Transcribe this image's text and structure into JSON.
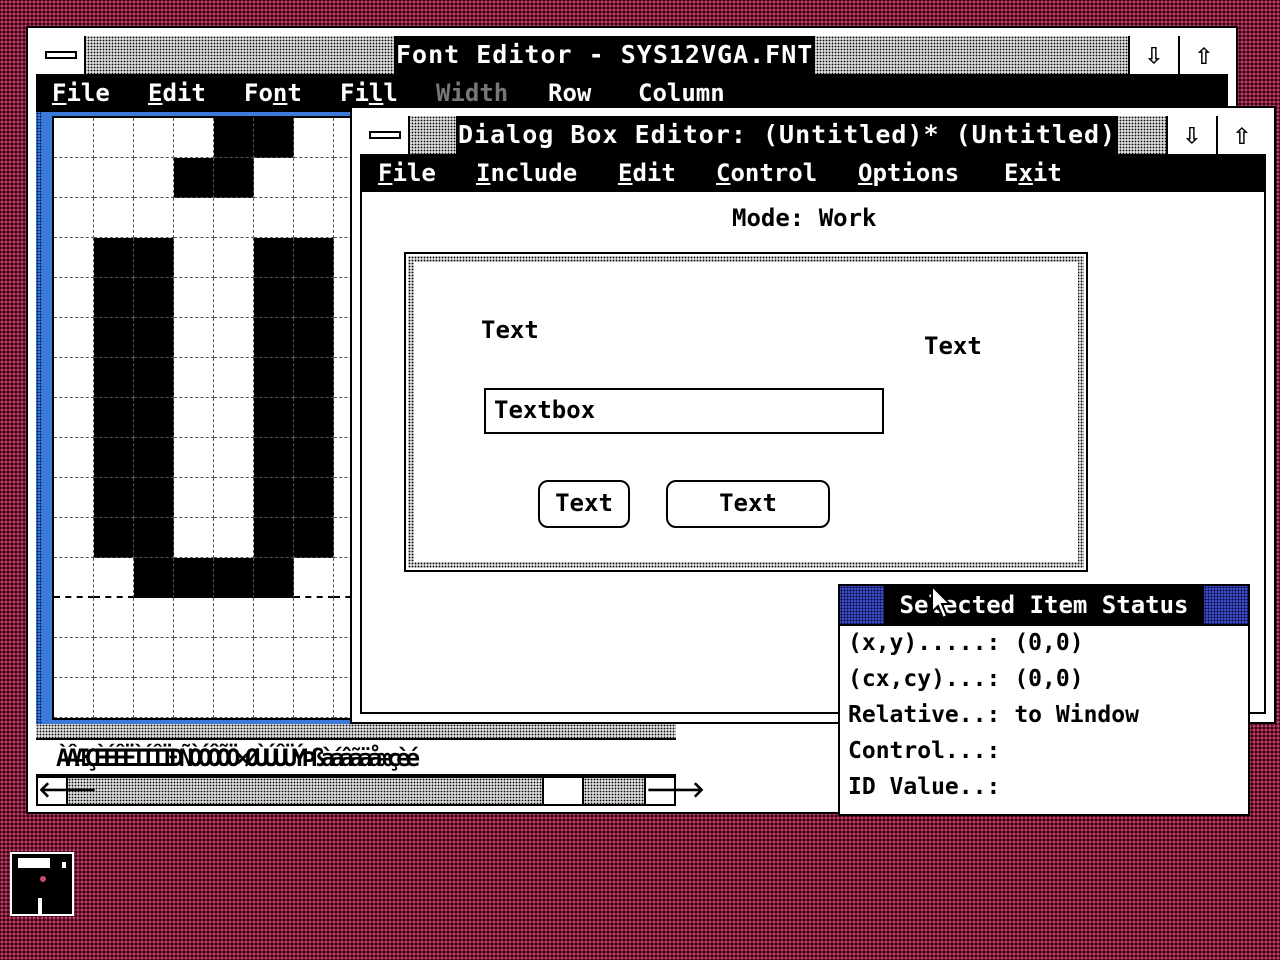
{
  "font_editor": {
    "title": "Font Editor - SYS12VGA.FNT",
    "menu": {
      "file": {
        "u": "F",
        "rest": "ile"
      },
      "edit": {
        "u": "E",
        "rest": "dit"
      },
      "font": {
        "pre": "Fo",
        "u": "n",
        "rest": "t"
      },
      "fill": {
        "pre": "Fi",
        "u": "l",
        "rest": "l"
      },
      "width": "Width",
      "row": "Row",
      "column": "Column"
    },
    "char_strip": "ÀÂÆÇÈÉÊËÌÍÎÏÐÑÒÓÔÕÖ×ØÙÚÛÜÝÞßàáâãäåæçèé",
    "grid_pattern": [
      "....XX..",
      "...XX...",
      "........",
      ".XX..XX.",
      ".XX..XX.",
      ".XX..XX.",
      ".XX..XX.",
      ".XX..XX.",
      ".XX..XX.",
      ".XX..XX.",
      ".XX..XX.",
      "..XXXX..",
      "........",
      "........",
      "........"
    ]
  },
  "dialog_editor": {
    "title": "Dialog Box Editor: (Untitled)* (Untitled)",
    "menu": {
      "file": {
        "u": "F",
        "rest": "ile"
      },
      "include": {
        "u": "I",
        "rest": "nclude"
      },
      "edit": {
        "u": "E",
        "rest": "dit"
      },
      "control": {
        "u": "C",
        "rest": "ontrol"
      },
      "options": {
        "u": "O",
        "rest": "ptions"
      },
      "exit": {
        "pre": "E",
        "u": "x",
        "rest": "it"
      }
    },
    "mode": "Mode: Work",
    "canvas": {
      "text1": "Text",
      "text2": "Text",
      "textbox": "Textbox",
      "button1": "Text",
      "button2": "Text"
    }
  },
  "status_panel": {
    "title": "Selected Item Status",
    "rows": [
      {
        "label": "(x,y).....:",
        "value": "(0,0)"
      },
      {
        "label": "(cx,cy)...:",
        "value": "(0,0)"
      },
      {
        "label": "Relative..:",
        "value": "to Window"
      },
      {
        "label": "Control...:",
        "value": ""
      },
      {
        "label": "ID Value..:",
        "value": ""
      }
    ]
  },
  "icons": [
    "system-menu-icon",
    "minimize-arrow-icon",
    "maximize-arrow-icon",
    "scroll-left-icon",
    "scroll-right-icon",
    "disk-icon",
    "mouse-pointer-icon"
  ],
  "colors": {
    "desktop": "#7a1838",
    "workspace": "#3a7ad8",
    "window": "#ffffff",
    "title": "#000000"
  }
}
